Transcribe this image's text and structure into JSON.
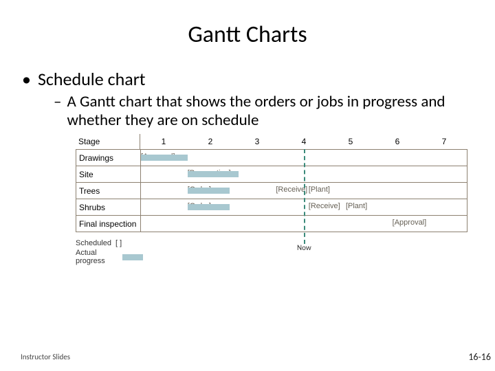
{
  "title": "Gantt Charts",
  "bullets": {
    "l1": "Schedule chart",
    "l2": "A Gantt chart that shows the orders or jobs in progress and whether they are on schedule"
  },
  "chart_data": {
    "type": "table",
    "stage_header": "Stage",
    "ticks": [
      "1",
      "2",
      "3",
      "4",
      "5",
      "6",
      "7"
    ],
    "rows": [
      {
        "name": "Drawings",
        "scheduled_label": "[Approval]",
        "scheduled_start": 1,
        "scheduled_end": 2,
        "actual_start": 1,
        "actual_end": 2
      },
      {
        "name": "Site",
        "scheduled_label": "[Preparation]",
        "scheduled_start": 2,
        "scheduled_end": 3,
        "actual_start": 2,
        "actual_end": 3.1
      },
      {
        "name": "Trees",
        "scheduled_label": "[Order]",
        "scheduled_start": 2,
        "scheduled_end": 3,
        "extra": [
          {
            "label": "[Receive]",
            "start": 3.9,
            "end": 4.6
          },
          {
            "label": "[Plant]",
            "start": 4.6,
            "end": 5.3
          }
        ],
        "actual_start": 2,
        "actual_end": 2.9
      },
      {
        "name": "Shrubs",
        "scheduled_label": "[Order]",
        "scheduled_start": 2,
        "scheduled_end": 3,
        "extra": [
          {
            "label": "[Receive]",
            "start": 4.6,
            "end": 5.4
          },
          {
            "label": "[Plant]",
            "start": 5.4,
            "end": 6.1
          }
        ],
        "actual_start": 2,
        "actual_end": 2.9
      },
      {
        "name": "Final inspection",
        "scheduled_label": "",
        "extra": [
          {
            "label": "[Approval]",
            "start": 6.4,
            "end": 7
          }
        ]
      }
    ],
    "now": 4.5,
    "now_label": "Now",
    "legend": {
      "scheduled": "Scheduled",
      "actual": "Actual progress",
      "bracket": "[          ]"
    }
  },
  "footer": {
    "left": "Instructor Slides",
    "right": "16-16"
  }
}
